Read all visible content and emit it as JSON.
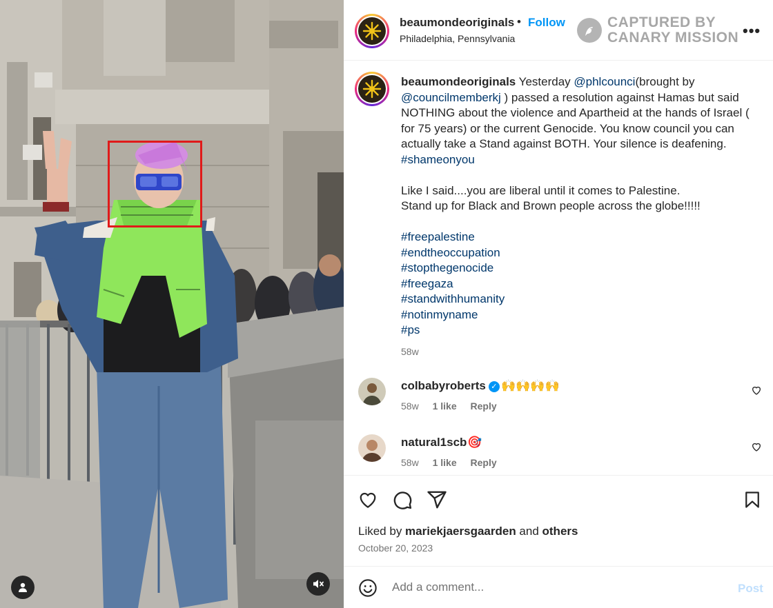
{
  "header": {
    "username": "beaumondeoriginals",
    "separator": "•",
    "follow_label": "Follow",
    "location": "Philadelphia, Pennsylvania",
    "watermark_line1": "CAPTURED BY",
    "watermark_line2": "CANARY MISSION",
    "more_label": "•••"
  },
  "caption": {
    "username": "beaumondeoriginals",
    "text_1": " Yesterday ",
    "mention_1": "@phlcounci",
    "text_2": "(brought by ",
    "mention_2": "@councilmemberkj",
    "text_3": " ) passed a resolution against Hamas but said NOTHING about the violence and Apartheid at the hands of Israel ( for 75 years) or the current Genocide. You know council you can actually take a Stand against BOTH. Your silence is deafening. ",
    "hashtag_inline": "#shameonyou",
    "line_a": "Like I said....you are liberal until it comes to Palestine.",
    "line_b": "Stand up for Black and Brown people across the globe!!!!!",
    "hashtags": [
      "#freepalestine",
      "#endtheoccupation",
      "#stopthegenocide",
      "#freegaza",
      "#standwithhumanity",
      "#notinmyname",
      "#ps"
    ],
    "time": "58w"
  },
  "comments": [
    {
      "username": "colbabyroberts",
      "verified": true,
      "text": "🙌🙌🙌🙌",
      "time": "58w",
      "likes": "1 like",
      "reply": "Reply"
    },
    {
      "username": "natural1scb",
      "verified": false,
      "text": "🎯",
      "time": "58w",
      "likes": "1 like",
      "reply": "Reply"
    }
  ],
  "actions": {
    "liked_prefix": "Liked by ",
    "liked_user": "mariekjaersgaarden",
    "liked_middle": " and ",
    "liked_others": "others",
    "date": "October 20, 2023"
  },
  "comment_box": {
    "placeholder": "Add a comment...",
    "post_label": "Post"
  },
  "colors": {
    "link": "#00376b",
    "follow": "#0095f6",
    "post_disabled": "#c0dffd",
    "face_box": "#e01a1a"
  },
  "icons": {
    "like": "heart-icon",
    "comment": "comment-icon",
    "share": "paper-plane-icon",
    "save": "bookmark-icon",
    "emoji": "smiley-icon",
    "tag": "user-tag-icon",
    "mute": "speaker-muted-icon"
  }
}
